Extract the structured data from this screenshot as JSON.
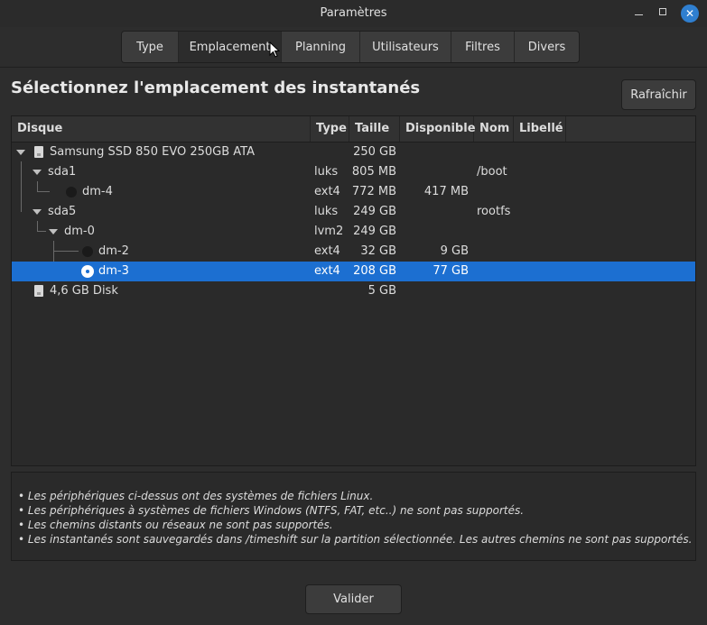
{
  "window": {
    "title": "Paramètres",
    "close_glyph": "✕"
  },
  "tabs": [
    {
      "label": "Type"
    },
    {
      "label": "Emplacement",
      "active": true
    },
    {
      "label": "Planning"
    },
    {
      "label": "Utilisateurs"
    },
    {
      "label": "Filtres"
    },
    {
      "label": "Divers"
    }
  ],
  "heading": "Sélectionnez l'emplacement des instantanés",
  "refresh_label": "Rafraîchir",
  "table": {
    "columns": [
      "Disque",
      "Type",
      "Taille",
      "Disponible",
      "Nom",
      "Libellé"
    ],
    "rows": [
      {
        "disk": "Samsung SSD 850 EVO 250GB ATA",
        "type": "",
        "size": "250 GB",
        "available": "",
        "name": "",
        "label": "",
        "icon": "drive-icon",
        "expanded": true
      },
      {
        "disk": "sda1",
        "type": "luks",
        "size": "805 MB",
        "available": "",
        "name": "/boot",
        "label": "",
        "expanded": true
      },
      {
        "disk": "dm-4",
        "type": "ext4",
        "size": "772 MB",
        "available": "417 MB",
        "name": "",
        "label": "",
        "radio": "unselected"
      },
      {
        "disk": "sda5",
        "type": "luks",
        "size": "249 GB",
        "available": "",
        "name": "rootfs",
        "label": "",
        "expanded": true
      },
      {
        "disk": "dm-0",
        "type": "lvm2",
        "size": "249 GB",
        "available": "",
        "name": "",
        "label": "",
        "expanded": true
      },
      {
        "disk": "dm-2",
        "type": "ext4",
        "size": "32 GB",
        "available": "9 GB",
        "name": "",
        "label": "",
        "radio": "unselected"
      },
      {
        "disk": "dm-3",
        "type": "ext4",
        "size": "208 GB",
        "available": "77 GB",
        "name": "",
        "label": "",
        "radio": "selected",
        "selected": true
      },
      {
        "disk": "4,6 GB Disk",
        "type": "",
        "size": "5 GB",
        "available": "",
        "name": "",
        "label": "",
        "icon": "drive-icon"
      }
    ]
  },
  "notes": [
    "• Les périphériques ci-dessus ont des systèmes de fichiers Linux.",
    "• Les périphériques à systèmes de fichiers Windows (NTFS, FAT, etc..) ne sont pas supportés.",
    "• Les chemins distants ou réseaux ne sont pas supportés.",
    "• Les instantanés sont sauvegardés dans /timeshift sur la partition sélectionnée. Les autres chemins ne sont pas supportés."
  ],
  "validate_label": "Valider",
  "colors": {
    "selection": "#1c6fd1",
    "background": "#2d2d2d",
    "close_button": "#2f7fd0"
  }
}
